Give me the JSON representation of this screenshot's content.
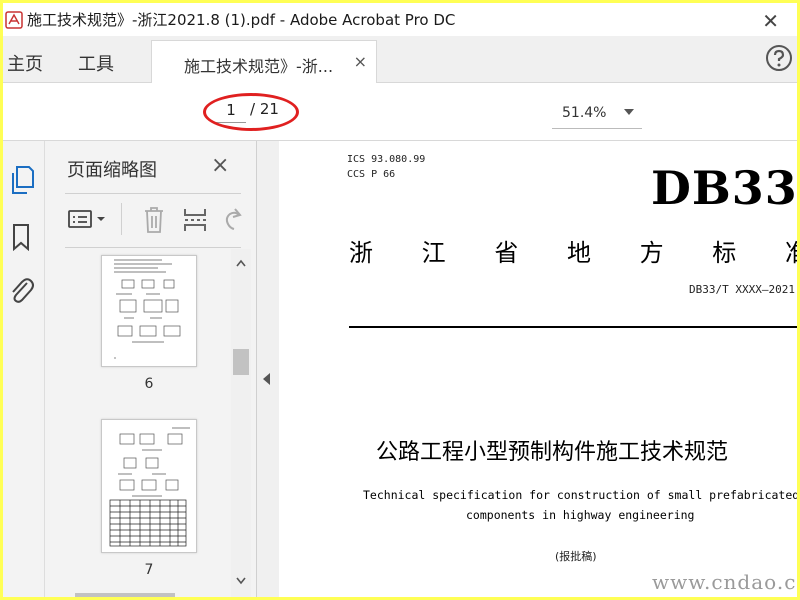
{
  "window": {
    "title": "施工技术规范》-浙江2021.8 (1).pdf - Adobe Acrobat Pro DC"
  },
  "tabs": {
    "home": "主页",
    "tools": "工具",
    "document": "施工技术规范》-浙...",
    "close": "×"
  },
  "toolbar": {
    "page_current": "1",
    "page_total": "/ 21",
    "zoom": "51.4%"
  },
  "thumbnail_panel": {
    "title": "页面缩略图",
    "close": "×",
    "thumbnails": [
      {
        "page": "6"
      },
      {
        "page": "7"
      }
    ]
  },
  "document": {
    "ics": "ICS  93.080.99",
    "ccs": "CCS  P 66",
    "code": "DB33",
    "standard_chars": [
      "浙",
      "江",
      "省",
      "地",
      "方",
      "标",
      "准"
    ],
    "standard_number": "DB33/T XXXX—2021",
    "title_cn": "公路工程小型预制构件施工技术规范",
    "title_en_line1": "Technical specification for construction of small prefabricated",
    "title_en_line2": "components in highway engineering",
    "draft": "(报批稿)"
  },
  "watermark": "www.cndao.com",
  "colors": {
    "highlight_ellipse": "#e02020",
    "accent_blue": "#1b6ec2",
    "frame": "#ffff55"
  }
}
